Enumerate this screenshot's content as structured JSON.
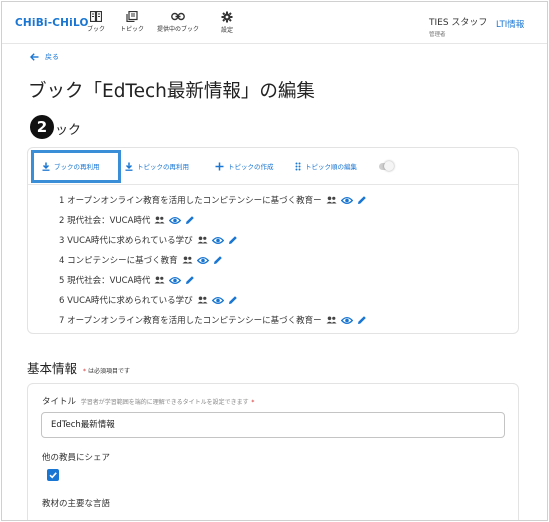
{
  "header": {
    "logo": "CHiBi-CHiLO",
    "nav": [
      {
        "label": "ブック",
        "icon": "book-icon"
      },
      {
        "label": "トピック",
        "icon": "topic-icon"
      },
      {
        "label": "提供中のブック",
        "icon": "link-icon"
      },
      {
        "label": "設定",
        "icon": "gear-icon"
      }
    ],
    "user_name": "TIES スタッフ",
    "user_role": "管理者",
    "lti_link": "LTI情報"
  },
  "back_label": "戻る",
  "page_title": "ブック「EdTech最新情報」の編集",
  "step_number": "2",
  "book_section_title": "ック",
  "toolbar": {
    "reuse_book": "ブックの再利用",
    "reuse_topic": "トピックの再利用",
    "create_topic": "トピックの作成",
    "reorder_topics": "トピック順の編集"
  },
  "topics": [
    {
      "label": "1 オープンオンライン教育を活用したコンピテンシーに基づく教育ー"
    },
    {
      "label": "2 現代社会：VUCA時代"
    },
    {
      "label": "3 VUCA時代に求められている学び"
    },
    {
      "label": "4 コンピテンシーに基づく教育"
    },
    {
      "label": "5 現代社会：VUCA時代"
    },
    {
      "label": "6 VUCA時代に求められている学び"
    },
    {
      "label": "7 オープンオンライン教育を活用したコンピテンシーに基づく教育ー"
    }
  ],
  "basic_info": {
    "title": "基本情報",
    "required_mark": "*",
    "required_note": "は必須項目です",
    "title_label": "タイトル",
    "title_hint": "学習者が学習範囲を端的に理解できるタイトルを設定できます",
    "title_star": "*",
    "title_value": "EdTech最新情報",
    "share_label": "他の教員にシェア",
    "share_checked": true,
    "language_label": "教材の主要な言語"
  },
  "colors": {
    "accent": "#1976d2",
    "highlight_border": "#3a8ed8",
    "required": "#d32f2f"
  }
}
